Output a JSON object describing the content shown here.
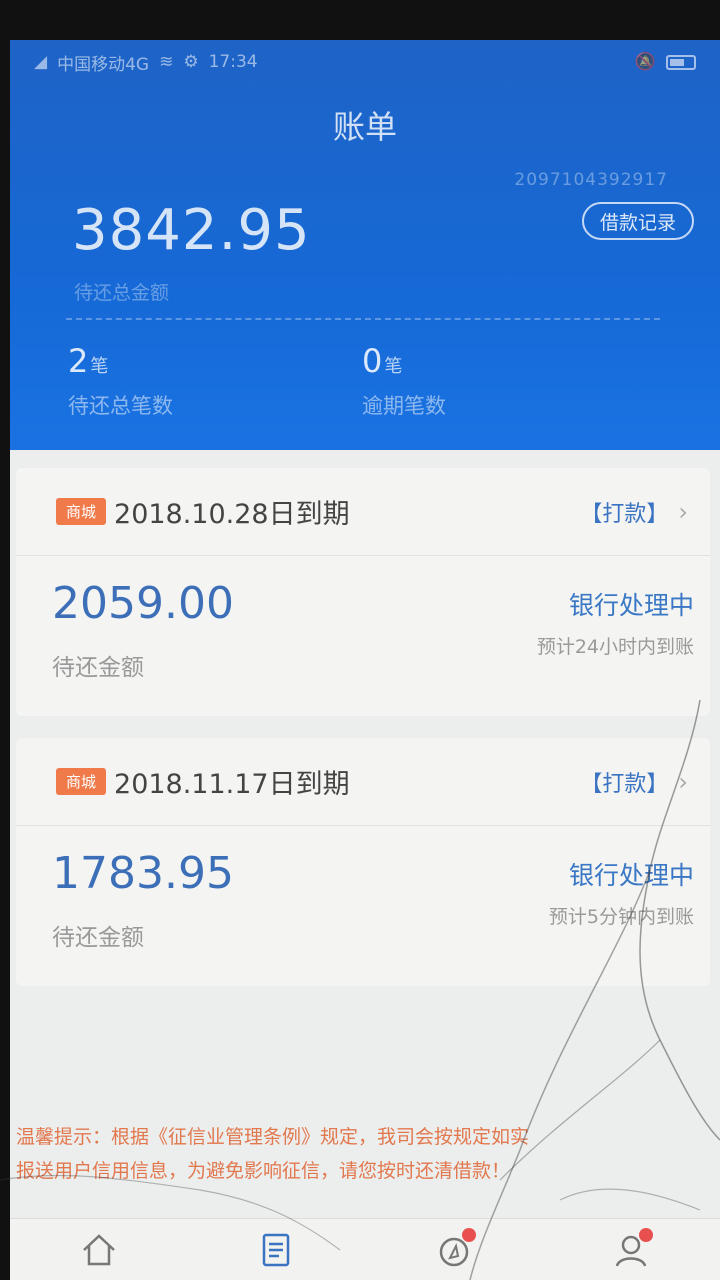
{
  "status_bar": {
    "carrier": "中国移动4G",
    "time": "17:34"
  },
  "header": {
    "title": "账单",
    "account_id": "2097104392917",
    "loan_record_button": "借款记录",
    "total_amount": "3842.95",
    "total_label": "待还总金额",
    "pending_count": "2",
    "pending_unit": "笔",
    "pending_label": "待还总笔数",
    "overdue_count": "0",
    "overdue_unit": "笔",
    "overdue_label": "逾期笔数"
  },
  "bills": [
    {
      "tag": "商城",
      "due_date": "2018.10.28日到期",
      "pay_label": "【打款】",
      "amount": "2059.00",
      "amount_label": "待还金额",
      "status": "银行处理中",
      "eta": "预计24小时内到账"
    },
    {
      "tag": "商城",
      "due_date": "2018.11.17日到期",
      "pay_label": "【打款】",
      "amount": "1783.95",
      "amount_label": "待还金额",
      "status": "银行处理中",
      "eta": "预计5分钟内到账"
    }
  ],
  "notice": {
    "line1": "温馨提示：根据《征信业管理条例》规定，我司会按规定如实",
    "line2": "报送用户信用信息，为避免影响征信，请您按时还清借款！"
  },
  "colors": {
    "header_blue": "#1669d6",
    "amount_blue": "#3c6fb8",
    "tag_orange": "#f07a4a",
    "notice_orange": "#e2784e",
    "badge_red": "#e8504f"
  },
  "icons": {
    "nav": [
      "home-icon",
      "bill-icon",
      "compass-icon",
      "profile-icon"
    ]
  }
}
